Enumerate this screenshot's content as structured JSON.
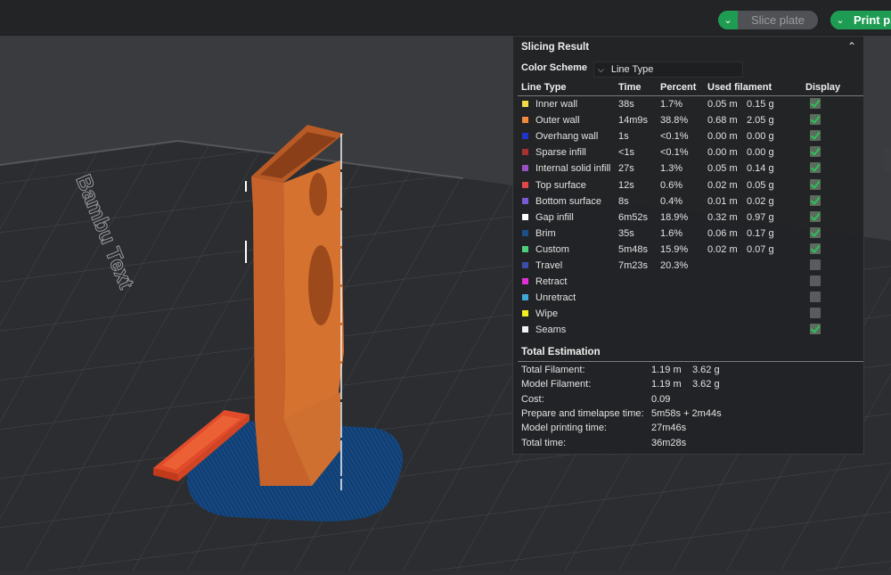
{
  "toolbar": {
    "slice_label": "Slice plate",
    "print_label": "Print p"
  },
  "viewport": {
    "bed_text": "Bambu Text"
  },
  "panel": {
    "title": "Slicing Result",
    "color_scheme_label": "Color Scheme",
    "color_scheme_value": "Line Type",
    "headers": {
      "line_type": "Line Type",
      "time": "Time",
      "percent": "Percent",
      "used_filament": "Used filament",
      "display": "Display"
    },
    "rows": [
      {
        "name": "Inner wall",
        "time": "38s",
        "percent": "1.7%",
        "meters": "0.05 m",
        "grams": "0.15 g",
        "display": true,
        "color": "#f2d94a"
      },
      {
        "name": "Outer wall",
        "time": "14m9s",
        "percent": "38.8%",
        "meters": "0.68 m",
        "grams": "2.05 g",
        "display": true,
        "color": "#f08a3c"
      },
      {
        "name": "Overhang wall",
        "time": "1s",
        "percent": "<0.1%",
        "meters": "0.00 m",
        "grams": "0.00 g",
        "display": true,
        "color": "#2233c8"
      },
      {
        "name": "Sparse infill",
        "time": "<1s",
        "percent": "<0.1%",
        "meters": "0.00 m",
        "grams": "0.00 g",
        "display": true,
        "color": "#a8322c"
      },
      {
        "name": "Internal solid infill",
        "time": "27s",
        "percent": "1.3%",
        "meters": "0.05 m",
        "grams": "0.14 g",
        "display": true,
        "color": "#9a4fc4"
      },
      {
        "name": "Top surface",
        "time": "12s",
        "percent": "0.6%",
        "meters": "0.02 m",
        "grams": "0.05 g",
        "display": true,
        "color": "#e04848"
      },
      {
        "name": "Bottom surface",
        "time": "8s",
        "percent": "0.4%",
        "meters": "0.01 m",
        "grams": "0.02 g",
        "display": true,
        "color": "#7a5ad0"
      },
      {
        "name": "Gap infill",
        "time": "6m52s",
        "percent": "18.9%",
        "meters": "0.32 m",
        "grams": "0.97 g",
        "display": true,
        "color": "#ffffff"
      },
      {
        "name": "Brim",
        "time": "35s",
        "percent": "1.6%",
        "meters": "0.06 m",
        "grams": "0.17 g",
        "display": true,
        "color": "#1a4f8a"
      },
      {
        "name": "Custom",
        "time": "5m48s",
        "percent": "15.9%",
        "meters": "0.02 m",
        "grams": "0.07 g",
        "display": true,
        "color": "#4fcf7a"
      },
      {
        "name": "Travel",
        "time": "7m23s",
        "percent": "20.3%",
        "meters": "",
        "grams": "",
        "display": false,
        "color": "#3a4fa8"
      },
      {
        "name": "Retract",
        "time": "",
        "percent": "",
        "meters": "",
        "grams": "",
        "display": false,
        "color": "#e030d8"
      },
      {
        "name": "Unretract",
        "time": "",
        "percent": "",
        "meters": "",
        "grams": "",
        "display": false,
        "color": "#3fa8d8"
      },
      {
        "name": "Wipe",
        "time": "",
        "percent": "",
        "meters": "",
        "grams": "",
        "display": false,
        "color": "#f2f020"
      },
      {
        "name": "Seams",
        "time": "",
        "percent": "",
        "meters": "",
        "grams": "",
        "display": true,
        "color": "#f2f2f2"
      }
    ],
    "total_title": "Total Estimation",
    "totals": [
      {
        "label": "Total Filament:",
        "v1": "1.19 m",
        "v2": "3.62 g"
      },
      {
        "label": "Model Filament:",
        "v1": "1.19 m",
        "v2": "3.62 g"
      },
      {
        "label": "Cost:",
        "v1": "0.09",
        "v2": ""
      },
      {
        "label": "Prepare and timelapse time:",
        "v1": "5m58s + 2m44s",
        "v2": ""
      },
      {
        "label": "Model printing time:",
        "v1": "27m46s",
        "v2": ""
      },
      {
        "label": "Total time:",
        "v1": "36m28s",
        "v2": ""
      }
    ]
  }
}
